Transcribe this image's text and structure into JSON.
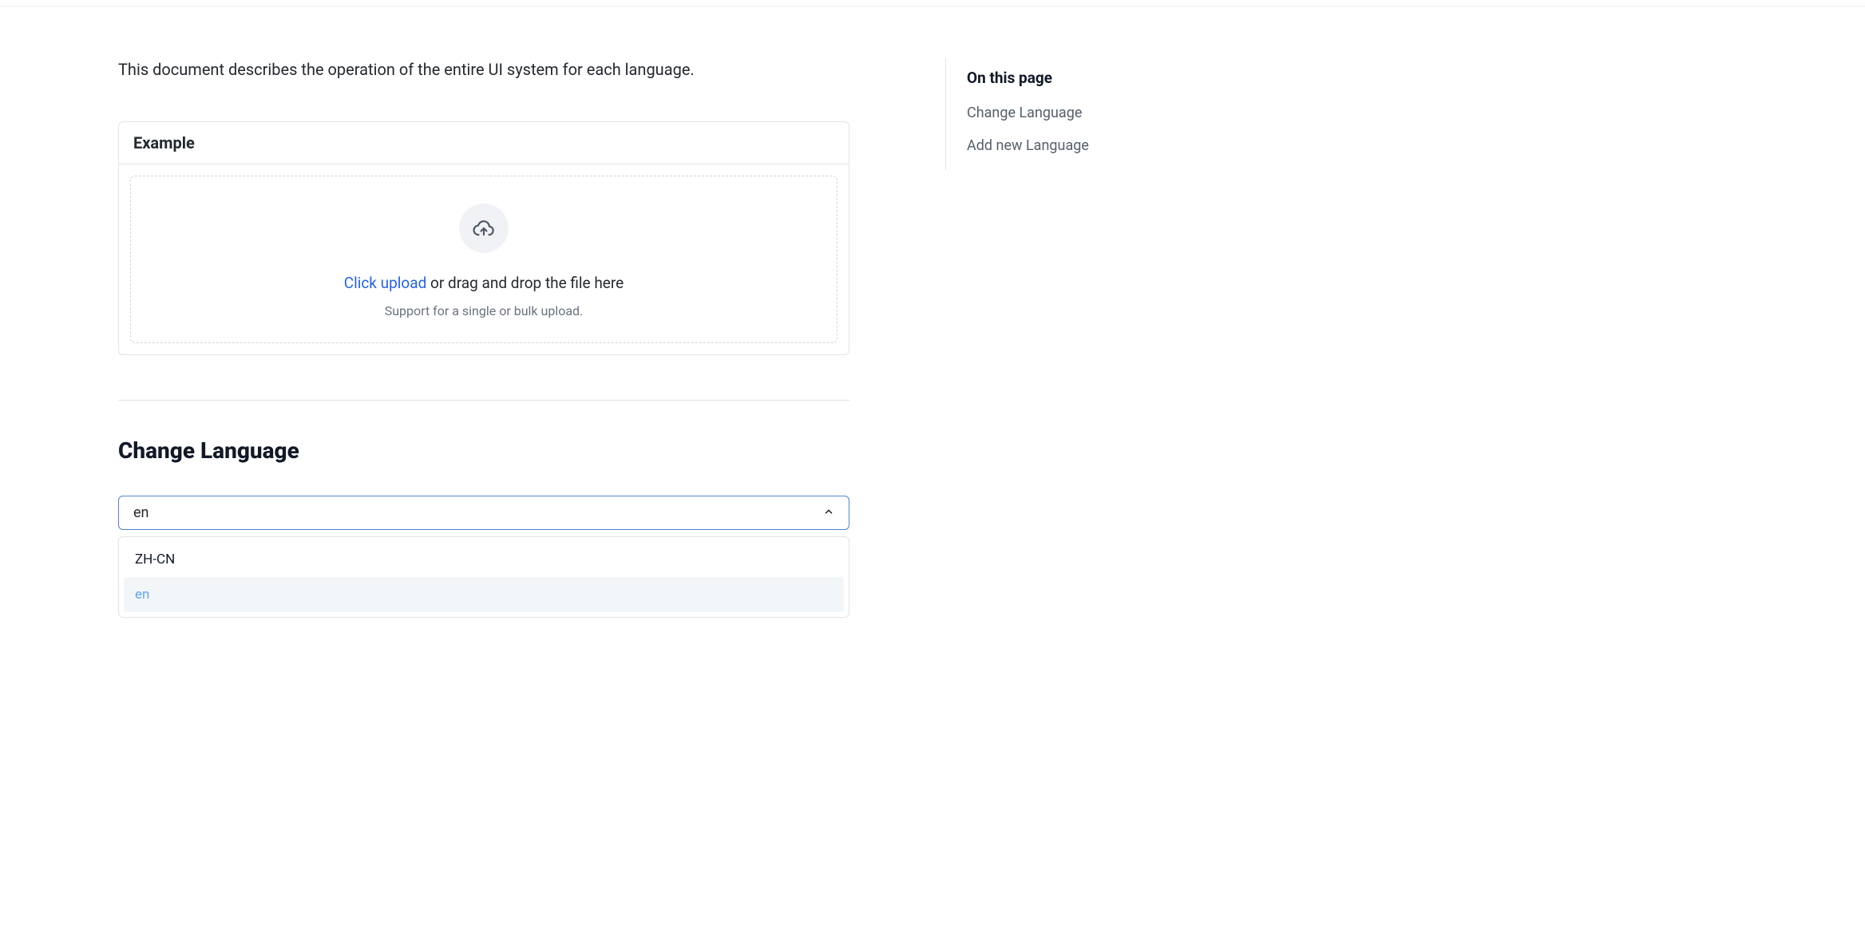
{
  "intro": "This document describes the operation of the entire UI system for each language.",
  "example": {
    "title": "Example",
    "upload_link": "Click upload",
    "upload_rest": " or drag and drop the file here",
    "upload_support": "Support for a single or bulk upload."
  },
  "change_language": {
    "title": "Change Language",
    "selected": "en",
    "options": {
      "0": {
        "label": "ZH-CN"
      },
      "1": {
        "label": "en"
      }
    }
  },
  "toc": {
    "title": "On this page",
    "items": {
      "0": {
        "label": "Change Language"
      },
      "1": {
        "label": "Add new Language"
      }
    }
  }
}
